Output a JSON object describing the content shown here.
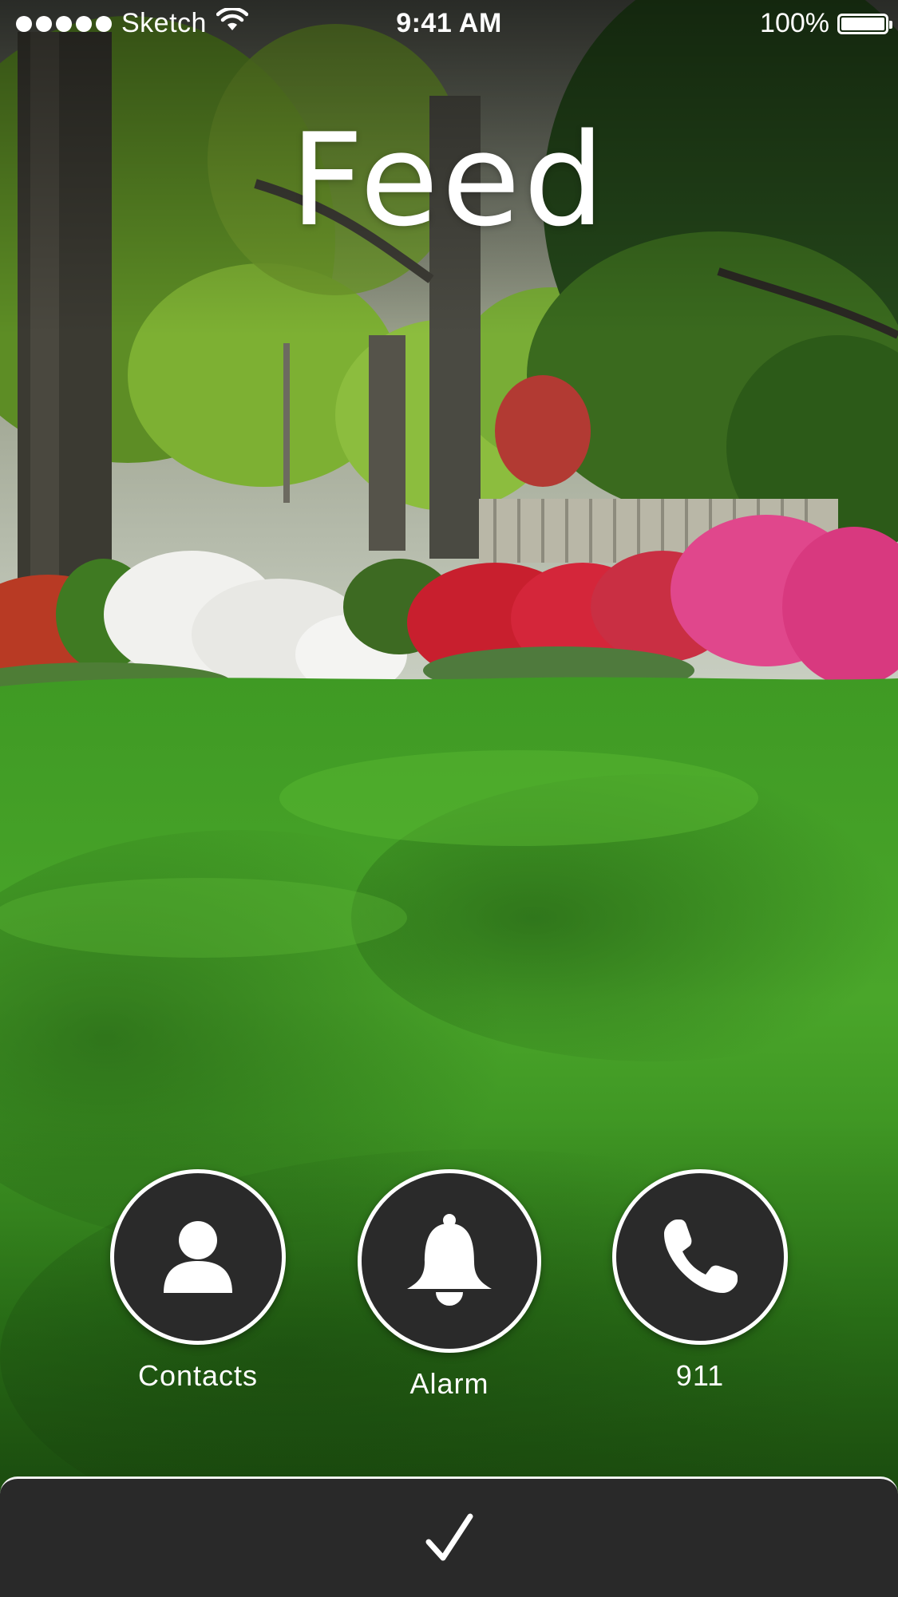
{
  "status_bar": {
    "signal_dots": 5,
    "carrier": "Sketch",
    "wifi_icon": "wifi-icon",
    "time": "9:41 AM",
    "battery_percent": "100%",
    "battery_level": 1.0
  },
  "header": {
    "title": "Feed"
  },
  "background": {
    "description_icon": "garden-photo"
  },
  "actions": [
    {
      "label": "Contacts",
      "icon": "person-icon"
    },
    {
      "label": "Alarm",
      "icon": "bell-icon"
    },
    {
      "label": "911",
      "icon": "phone-icon"
    }
  ],
  "bottom_bar": {
    "icon": "checkmark-icon"
  },
  "colors": {
    "button_fill": "#2a2a2a",
    "button_border": "#ffffff",
    "bottom_bar": "#292929",
    "text": "#ffffff"
  }
}
